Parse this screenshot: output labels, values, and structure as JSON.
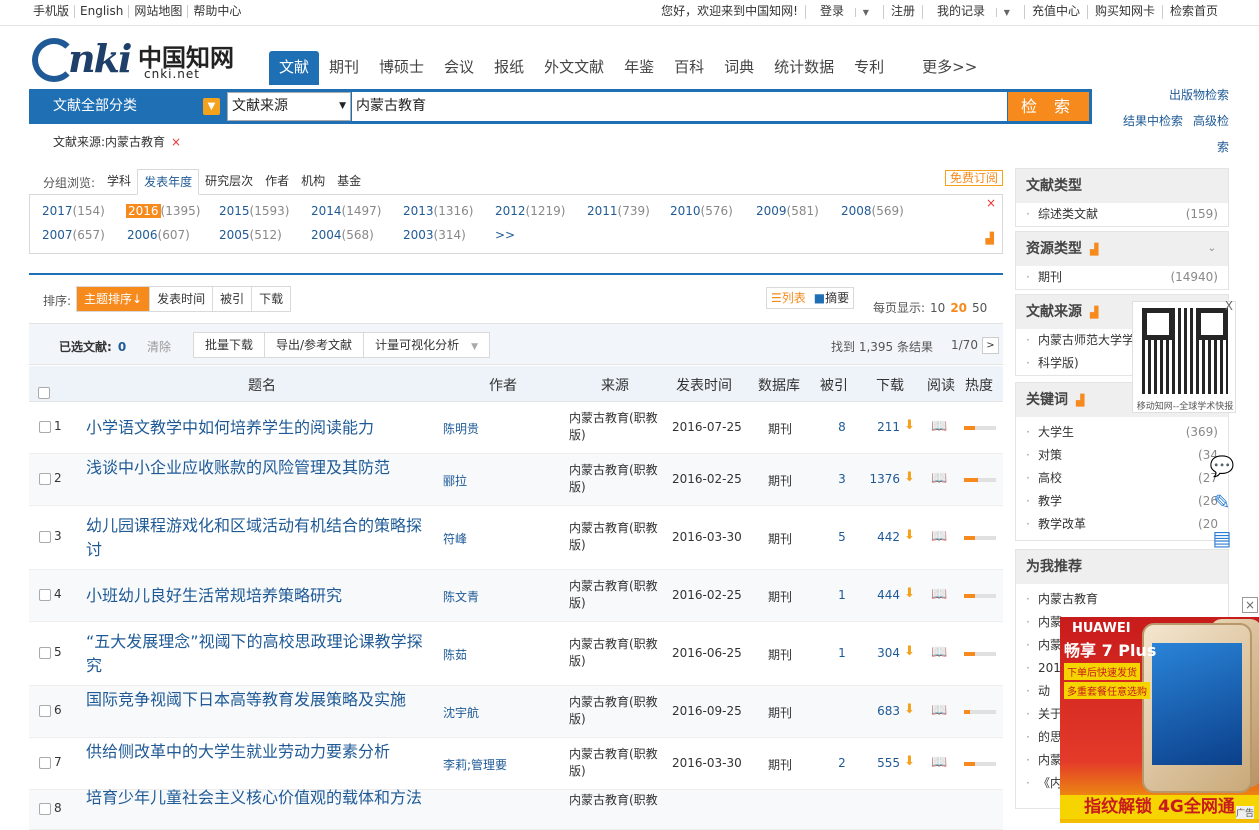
{
  "topbar": {
    "left": [
      "手机版",
      "English",
      "网站地图",
      "帮助中心"
    ],
    "welcome": "您好，欢迎来到中国知网!",
    "login": "登录",
    "register": "注册",
    "myrecord": "我的记录",
    "recharge": "充值中心",
    "buycard": "购买知网卡",
    "home": "检索首页"
  },
  "logo": {
    "text": "nki",
    "cn": "中国知网",
    "net": "cnki.net"
  },
  "navtabs": [
    "文献",
    "期刊",
    "博硕士",
    "会议",
    "报纸",
    "外文文献",
    "年鉴",
    "百科",
    "词典",
    "统计数据",
    "专利",
    "更多>>"
  ],
  "search": {
    "category": "文献全部分类",
    "field": "文献来源",
    "query": "内蒙古教育",
    "button": "检 索"
  },
  "rightlinks": {
    "pub": "出版物检索",
    "inresult": "结果中检索",
    "advanced": "高级检索"
  },
  "filter": {
    "tag": "文献来源:内蒙古教育",
    "remove": "×"
  },
  "group": {
    "label": "分组浏览:",
    "tabs": [
      "学科",
      "发表年度",
      "研究层次",
      "作者",
      "机构",
      "基金"
    ],
    "subscribe": "免费订阅",
    "years": [
      {
        "y": "2017",
        "c": "(154)"
      },
      {
        "y": "2016",
        "c": "(1395)"
      },
      {
        "y": "2015",
        "c": "(1593)"
      },
      {
        "y": "2014",
        "c": "(1497)"
      },
      {
        "y": "2013",
        "c": "(1316)"
      },
      {
        "y": "2012",
        "c": "(1219)"
      },
      {
        "y": "2011",
        "c": "(739)"
      },
      {
        "y": "2010",
        "c": "(576)"
      },
      {
        "y": "2009",
        "c": "(581)"
      },
      {
        "y": "2008",
        "c": "(569)"
      },
      {
        "y": "2007",
        "c": "(657)"
      },
      {
        "y": "2006",
        "c": "(607)"
      },
      {
        "y": "2005",
        "c": "(512)"
      },
      {
        "y": "2004",
        "c": "(568)"
      },
      {
        "y": "2003",
        "c": "(314)"
      }
    ],
    "more": ">>",
    "close": "×"
  },
  "sort": {
    "label": "排序:",
    "options": [
      "主题排序↓",
      "发表时间",
      "被引",
      "下载"
    ],
    "view_list": "列表",
    "view_abs": "摘要",
    "perpage_label": "每页显示:",
    "perpage": [
      "10",
      "20",
      "50"
    ]
  },
  "selected": {
    "label": "已选文献:",
    "count": "0",
    "clear": "清除",
    "actions": [
      "批量下载",
      "导出/参考文献",
      "计量可视化分析"
    ],
    "found": "找到 1,395 条结果",
    "page": "1/70",
    "next": ">"
  },
  "columns": [
    "题名",
    "作者",
    "来源",
    "发表时间",
    "数据库",
    "被引",
    "下载",
    "阅读",
    "热度"
  ],
  "rows": [
    {
      "no": "1",
      "title": "小学语文教学中如何培养学生的阅读能力",
      "author": "陈明贵",
      "source": "内蒙古教育(职教版)",
      "date": "2016-07-25",
      "db": "期刊",
      "cite": "8",
      "dl": "211",
      "heat": 0.35
    },
    {
      "no": "2",
      "title": "浅谈中小企业应收账款的风险管理及其防范",
      "author": "郦拉",
      "source": "内蒙古教育(职教版)",
      "date": "2016-02-25",
      "db": "期刊",
      "cite": "3",
      "dl": "1376",
      "heat": 0.45
    },
    {
      "no": "3",
      "title": "幼儿园课程游戏化和区域活动有机结合的策略探讨",
      "author": "符峰",
      "source": "内蒙古教育(职教版)",
      "date": "2016-03-30",
      "db": "期刊",
      "cite": "5",
      "dl": "442",
      "heat": 0.35
    },
    {
      "no": "4",
      "title": "小班幼儿良好生活常规培养策略研究",
      "author": "陈文青",
      "source": "内蒙古教育(职教版)",
      "date": "2016-02-25",
      "db": "期刊",
      "cite": "1",
      "dl": "444",
      "heat": 0.35
    },
    {
      "no": "5",
      "title": "“五大发展理念”视阈下的高校思政理论课教学探究",
      "author": "陈茹",
      "source": "内蒙古教育(职教版)",
      "date": "2016-06-25",
      "db": "期刊",
      "cite": "1",
      "dl": "304",
      "heat": 0.35
    },
    {
      "no": "6",
      "title": "国际竞争视阈下日本高等教育发展策略及实施",
      "author": "沈宇航",
      "source": "内蒙古教育(职教版)",
      "date": "2016-09-25",
      "db": "期刊",
      "cite": "",
      "dl": "683",
      "heat": 0.2
    },
    {
      "no": "7",
      "title": "供给侧改革中的大学生就业劳动力要素分析",
      "author": "李莉;管理要",
      "source": "内蒙古教育(职教版)",
      "date": "2016-03-30",
      "db": "期刊",
      "cite": "2",
      "dl": "555",
      "heat": 0.35
    },
    {
      "no": "8",
      "title": "培育少年儿童社会主义核心价值观的载体和方法",
      "author": "",
      "source": "内蒙古教育(职教",
      "date": "",
      "db": "",
      "cite": "",
      "dl": "",
      "heat": 0
    }
  ],
  "sidebar": {
    "doctype": {
      "title": "文献类型",
      "items": [
        {
          "name": "综述类文献",
          "n": "(159)"
        }
      ]
    },
    "restype": {
      "title": "资源类型",
      "items": [
        {
          "name": "期刊",
          "n": "(14940)"
        }
      ]
    },
    "docsrc": {
      "title": "文献来源",
      "items": [
        {
          "name": "内蒙古师范大学学",
          "n": ""
        },
        {
          "name": "科学版)",
          "n": ""
        }
      ]
    },
    "keywords": {
      "title": "关键词",
      "items": [
        {
          "name": "大学生",
          "n": "(369)"
        },
        {
          "name": "对策",
          "n": "(34"
        },
        {
          "name": "高校",
          "n": "(27"
        },
        {
          "name": "教学",
          "n": "(26"
        },
        {
          "name": "教学改革",
          "n": "(20"
        }
      ]
    },
    "recommend": {
      "title": "为我推荐",
      "items": [
        "内蒙古教育",
        "内蒙",
        "内蒙",
        "201",
        "动",
        "关于",
        "的思",
        "内蒙",
        "《内"
      ]
    }
  },
  "qr": {
    "caption": "移动知网--全球学术快报",
    "close": "X"
  },
  "ad": {
    "brand": "HUAWEI",
    "model": "畅享 7 Plus",
    "l1": "下单后快速发货",
    "l2": "多重套餐任意选购",
    "bottom": "指纹解锁 4G全网通",
    "close": "×",
    "tag": "广告"
  }
}
